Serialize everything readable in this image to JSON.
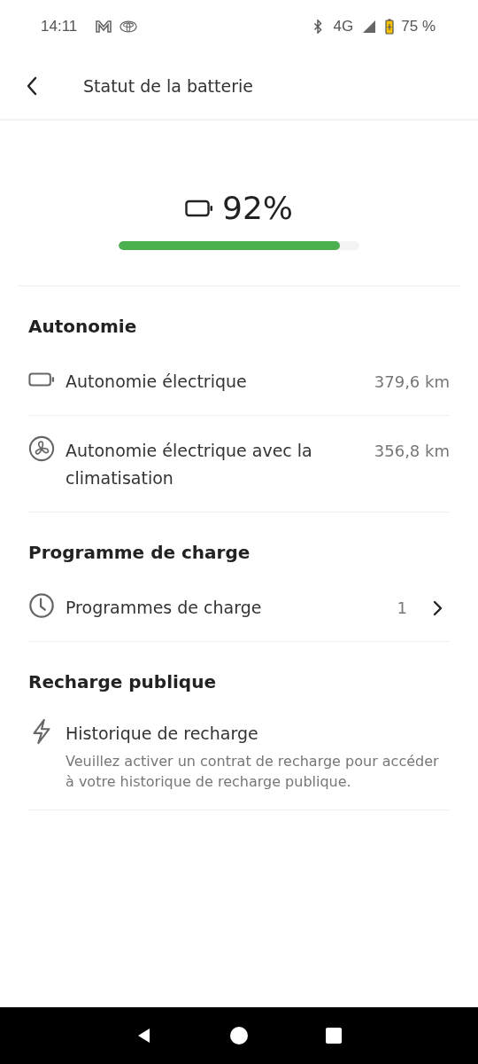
{
  "status_bar": {
    "time": "14:11",
    "network": "4G",
    "battery": "75 %"
  },
  "header": {
    "title": "Statut de la batterie"
  },
  "battery": {
    "percent": "92%",
    "level": 0.92
  },
  "sections": [
    {
      "title": "Autonomie",
      "rows": [
        {
          "kind": "value",
          "label": "Autonomie électrique",
          "value": "379,6 km"
        },
        {
          "kind": "value",
          "label": "Autonomie électrique avec la climatisation",
          "value": "356,8 km"
        }
      ]
    },
    {
      "title": "Programme de charge",
      "rows": [
        {
          "kind": "link",
          "label": "Programmes de charge",
          "value": "1"
        }
      ]
    },
    {
      "title": "Recharge publique",
      "rows": [
        {
          "kind": "info",
          "label": "Historique de recharge",
          "description": "Veuillez activer un contrat de recharge pour accéder à votre historique de recharge publique."
        }
      ]
    }
  ]
}
